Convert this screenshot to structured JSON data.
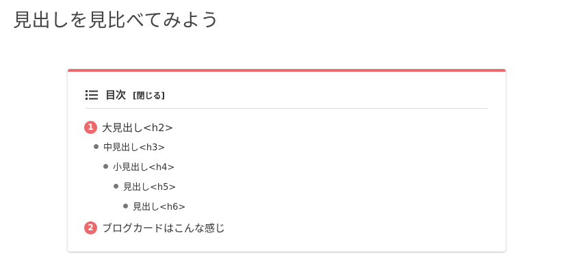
{
  "page": {
    "title": "見出しを見比べてみよう"
  },
  "toc": {
    "title": "目次",
    "toggle_label": "[閉じる]",
    "items": [
      {
        "number": "1",
        "label": "大見出し<h2>"
      },
      {
        "label": "中見出し<h3>"
      },
      {
        "label": "小見出し<h4>"
      },
      {
        "label": "見出し<h5>"
      },
      {
        "label": "見出し<h6>"
      },
      {
        "number": "2",
        "label": "ブログカードはこんな感じ"
      }
    ]
  },
  "colors": {
    "accent": "#ec6a6e",
    "bullet": "#777777",
    "text": "#333333"
  },
  "icons": {
    "toc_icon": "list-icon"
  }
}
